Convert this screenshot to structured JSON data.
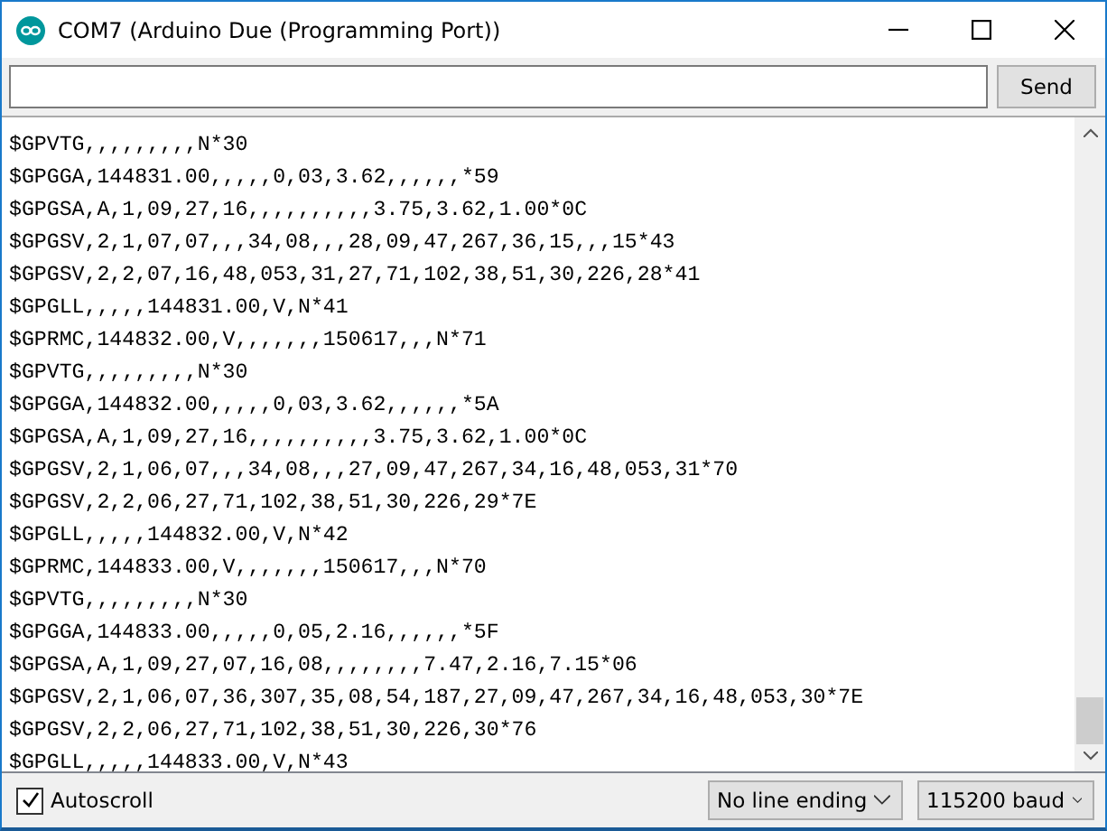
{
  "window": {
    "title": "COM7 (Arduino Due (Programming Port))"
  },
  "send_button": "Send",
  "output_lines": [
    "$GPVTG,,,,,,,,,N*30",
    "$GPGGA,144831.00,,,,,0,03,3.62,,,,,,*59",
    "$GPGSA,A,1,09,27,16,,,,,,,,,,3.75,3.62,1.00*0C",
    "$GPGSV,2,1,07,07,,,34,08,,,28,09,47,267,36,15,,,15*43",
    "$GPGSV,2,2,07,16,48,053,31,27,71,102,38,51,30,226,28*41",
    "$GPGLL,,,,,144831.00,V,N*41",
    "$GPRMC,144832.00,V,,,,,,,150617,,,N*71",
    "$GPVTG,,,,,,,,,N*30",
    "$GPGGA,144832.00,,,,,0,03,3.62,,,,,,*5A",
    "$GPGSA,A,1,09,27,16,,,,,,,,,,3.75,3.62,1.00*0C",
    "$GPGSV,2,1,06,07,,,34,08,,,27,09,47,267,34,16,48,053,31*70",
    "$GPGSV,2,2,06,27,71,102,38,51,30,226,29*7E",
    "$GPGLL,,,,,144832.00,V,N*42",
    "$GPRMC,144833.00,V,,,,,,,150617,,,N*70",
    "$GPVTG,,,,,,,,,N*30",
    "$GPGGA,144833.00,,,,,0,05,2.16,,,,,,*5F",
    "$GPGSA,A,1,09,27,07,16,08,,,,,,,,7.47,2.16,7.15*06",
    "$GPGSV,2,1,06,07,36,307,35,08,54,187,27,09,47,267,34,16,48,053,30*7E",
    "$GPGSV,2,2,06,27,71,102,38,51,30,226,30*76",
    "$GPGLL,,,,,144833.00,V,N*43"
  ],
  "autoscroll": {
    "label": "Autoscroll",
    "checked": true
  },
  "line_ending": "No line ending",
  "baud_rate": "115200 baud"
}
